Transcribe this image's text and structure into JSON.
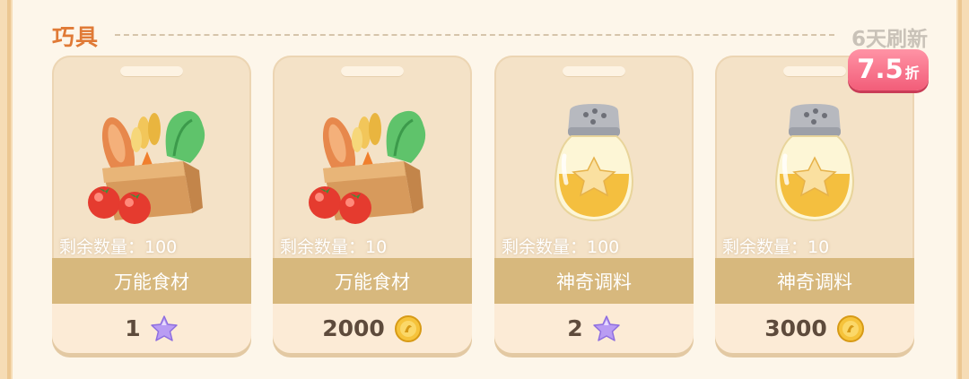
{
  "section": {
    "title": "巧具",
    "refresh": "6天刷新"
  },
  "items": [
    {
      "stock": "剩余数量：100",
      "name": "万能食材",
      "price": "1",
      "currency_icon": "star-icon",
      "art": "food-basket-icon"
    },
    {
      "stock": "剩余数量：10",
      "name": "万能食材",
      "price": "2000",
      "currency_icon": "coin-icon",
      "art": "food-basket-icon"
    },
    {
      "stock": "剩余数量：100",
      "name": "神奇调料",
      "price": "2",
      "currency_icon": "star-icon",
      "art": "seasoning-jar-icon"
    },
    {
      "stock": "剩余数量：10",
      "name": "神奇调料",
      "price": "3000",
      "currency_icon": "coin-icon",
      "art": "seasoning-jar-icon",
      "discount": {
        "value": "7.5",
        "unit": "折"
      }
    }
  ],
  "colors": {
    "title": "#e07a36",
    "card": "#f4e2c7",
    "band": "#d7b87d",
    "discount": "#f25d79"
  }
}
